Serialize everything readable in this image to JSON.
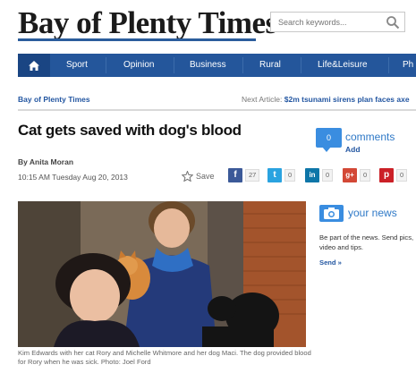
{
  "header": {
    "logo_text": "Bay of Plenty Times",
    "search": {
      "placeholder": "Search keywords...",
      "icon": "search-icon"
    }
  },
  "nav": {
    "home_icon": "home-icon",
    "items": [
      "Sport",
      "Opinion",
      "Business",
      "Rural",
      "Life&Leisure",
      "Ph"
    ]
  },
  "breadcrumb": "Bay of Plenty Times",
  "next_article": {
    "label": "Next Article:",
    "title": "$2m tsunami sirens plan faces axe"
  },
  "article": {
    "headline": "Cat gets saved with dog's blood",
    "author": "By Anita Moran",
    "date": "10:15 AM Tuesday Aug 20, 2013",
    "save_label": "Save",
    "caption": "Kim Edwards with her cat Rory and Michelle Whitmore and her dog Maci. The dog provided blood for Rory when he was sick. Photo: Joel Ford"
  },
  "comments": {
    "count": "0",
    "label": "comments",
    "add_label": "Add"
  },
  "social": [
    {
      "network": "facebook",
      "glyph": "f",
      "count": "27",
      "color": "#3b5998"
    },
    {
      "network": "twitter",
      "glyph": "t",
      "count": "0",
      "color": "#2aa3e0"
    },
    {
      "network": "linkedin",
      "glyph": "in",
      "count": "0",
      "color": "#0e76a8"
    },
    {
      "network": "google-plus",
      "glyph": "g+",
      "count": "0",
      "color": "#d34836"
    },
    {
      "network": "pinterest",
      "glyph": "p",
      "count": "0",
      "color": "#cb2027"
    }
  ],
  "your_news": {
    "title": "your news",
    "description": "Be part of the news. Send pics, video and tips.",
    "send_label": "Send »"
  },
  "colors": {
    "brand_blue": "#24569b",
    "accent_blue": "#3a8de0",
    "link_blue": "#2356a1"
  }
}
